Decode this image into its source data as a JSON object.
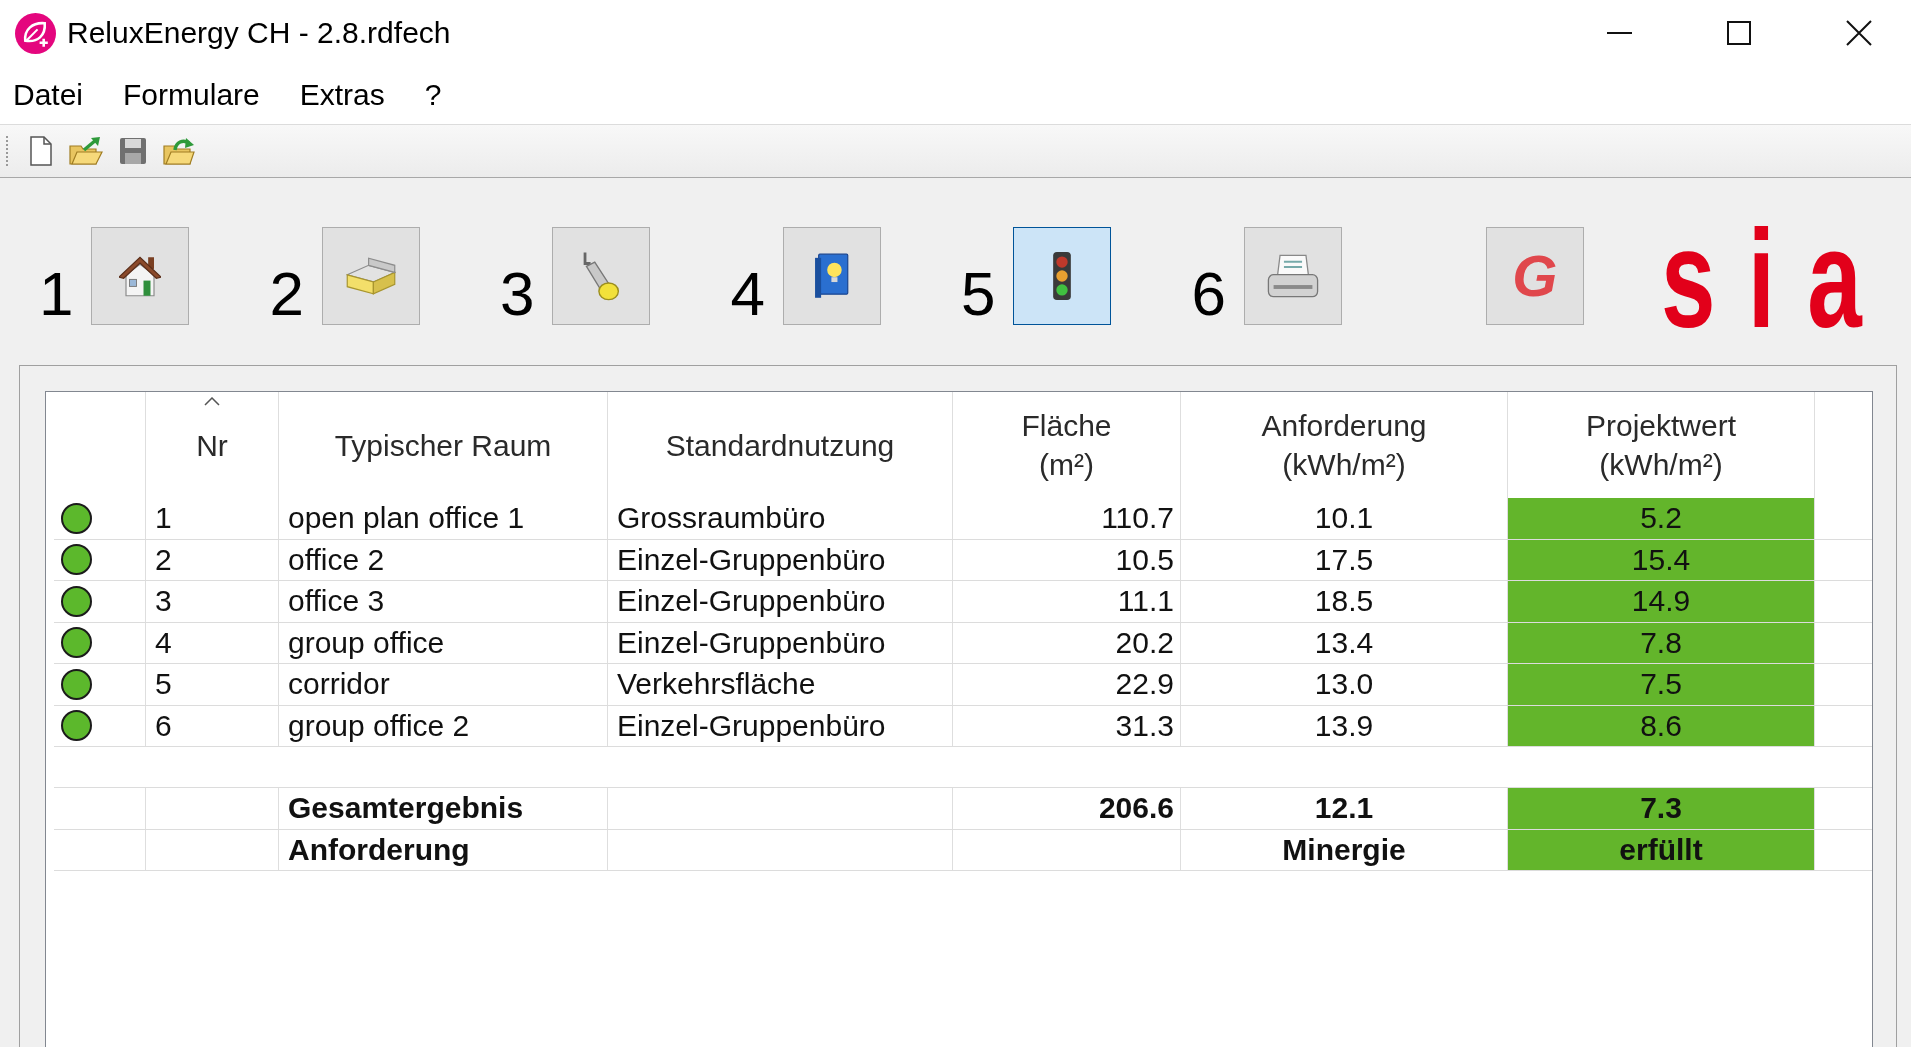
{
  "window": {
    "title": "ReluxEnergy CH - 2.8.rdfech"
  },
  "menu": [
    "Datei",
    "Formulare",
    "Extras",
    "?"
  ],
  "steps": [
    {
      "number": "1",
      "selected": false
    },
    {
      "number": "2",
      "selected": false
    },
    {
      "number": "3",
      "selected": false
    },
    {
      "number": "4",
      "selected": false
    },
    {
      "number": "5",
      "selected": true
    },
    {
      "number": "6",
      "selected": false
    }
  ],
  "extra_button": {
    "label": "G"
  },
  "logo": {
    "text": "sia"
  },
  "table": {
    "columns": [
      {
        "label": "Nr",
        "sorted": true
      },
      {
        "label": "Typischer Raum",
        "sorted": false
      },
      {
        "label": "Standardnutzung",
        "sorted": false
      },
      {
        "label": "Fläche",
        "unit": "(m²)",
        "sorted": false
      },
      {
        "label": "Anforderung",
        "unit": "(kWh/m²)",
        "sorted": false
      },
      {
        "label": "Projektwert",
        "unit": "(kWh/m²)",
        "sorted": false
      }
    ],
    "rows": [
      {
        "ok": true,
        "nr": "1",
        "room": "open plan office 1",
        "usage": "Grossraumbüro",
        "area": "110.7",
        "requirement": "10.1",
        "value": "5.2"
      },
      {
        "ok": true,
        "nr": "2",
        "room": "office 2",
        "usage": "Einzel-Gruppenbüro",
        "area": "10.5",
        "requirement": "17.5",
        "value": "15.4"
      },
      {
        "ok": true,
        "nr": "3",
        "room": "office 3",
        "usage": "Einzel-Gruppenbüro",
        "area": "11.1",
        "requirement": "18.5",
        "value": "14.9"
      },
      {
        "ok": true,
        "nr": "4",
        "room": "group office",
        "usage": "Einzel-Gruppenbüro",
        "area": "20.2",
        "requirement": "13.4",
        "value": "7.8"
      },
      {
        "ok": true,
        "nr": "5",
        "room": "corridor",
        "usage": "Verkehrsfläche",
        "area": "22.9",
        "requirement": "13.0",
        "value": "7.5"
      },
      {
        "ok": true,
        "nr": "6",
        "room": "group office 2",
        "usage": "Einzel-Gruppenbüro",
        "area": "31.3",
        "requirement": "13.9",
        "value": "8.6"
      }
    ],
    "summary": [
      {
        "label": "Gesamtergebnis",
        "area": "206.6",
        "requirement": "12.1",
        "value": "7.3",
        "ok": true
      },
      {
        "label": "Anforderung",
        "requirement": "Minergie",
        "value": "erfüllt",
        "ok": true
      }
    ]
  }
}
